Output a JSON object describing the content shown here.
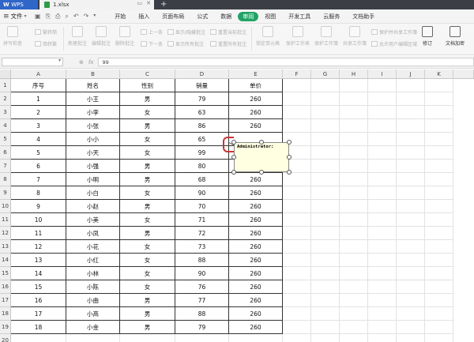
{
  "titlebar": {
    "app_name": "WPS",
    "file_name": "1.xlsx"
  },
  "menubar": {
    "file_label": "文件",
    "items": [
      "开始",
      "插入",
      "页面布局",
      "公式",
      "数据",
      "审阅",
      "视图",
      "开发工具",
      "云服务",
      "文档助手"
    ],
    "active": "审阅"
  },
  "ribbon": {
    "spell_check": "拼写检查",
    "trad_to_simp": "繁转简",
    "simp_to_trad": "简转繁",
    "new_comment": "新建批注",
    "edit_comment": "编辑批注",
    "delete_comment": "删除批注",
    "prev": "上一条",
    "next": "下一条",
    "show_hide_comment": "显示/隐藏批注",
    "show_all_comments": "显示所有批注",
    "reset_current_comment": "重置当前批注",
    "reset_all_comments": "重置所有批注",
    "lock_cell": "锁定单元格",
    "protect_sheet": "保护工作表",
    "protect_workbook": "保护工作簿",
    "share_workbook": "共享工作簿",
    "protect_and_share": "保护并共享工作簿",
    "allow_edit_ranges": "允许用户编辑区域",
    "track_changes": "修订",
    "doc_encrypt": "文档加密"
  },
  "formulabar": {
    "fx": "fx",
    "value": "99"
  },
  "grid": {
    "columns": [
      "A",
      "B",
      "C",
      "D",
      "E",
      "F",
      "G",
      "H",
      "I",
      "J",
      "K"
    ],
    "header_row": [
      "序号",
      "姓名",
      "性别",
      "销量",
      "单价"
    ],
    "rows": [
      [
        "1",
        "小王",
        "男",
        "79",
        "260"
      ],
      [
        "2",
        "小李",
        "女",
        "63",
        "260"
      ],
      [
        "3",
        "小张",
        "男",
        "86",
        "260"
      ],
      [
        "4",
        "小小",
        "女",
        "65",
        ""
      ],
      [
        "5",
        "小天",
        "女",
        "99",
        ""
      ],
      [
        "6",
        "小强",
        "男",
        "80",
        ""
      ],
      [
        "7",
        "小明",
        "男",
        "68",
        "260"
      ],
      [
        "8",
        "小白",
        "女",
        "90",
        "260"
      ],
      [
        "9",
        "小赵",
        "男",
        "70",
        "260"
      ],
      [
        "10",
        "小美",
        "女",
        "71",
        "260"
      ],
      [
        "11",
        "小凤",
        "男",
        "72",
        "260"
      ],
      [
        "12",
        "小花",
        "女",
        "73",
        "260"
      ],
      [
        "13",
        "小红",
        "女",
        "88",
        "260"
      ],
      [
        "14",
        "小林",
        "女",
        "90",
        "260"
      ],
      [
        "15",
        "小陈",
        "女",
        "76",
        "260"
      ],
      [
        "16",
        "小曲",
        "男",
        "77",
        "260"
      ],
      [
        "17",
        "小高",
        "男",
        "88",
        "260"
      ],
      [
        "18",
        "小金",
        "男",
        "79",
        "260"
      ]
    ],
    "row_numbers": [
      "1",
      "2",
      "3",
      "4",
      "5",
      "6",
      "7",
      "8",
      "9",
      "10",
      "11",
      "12",
      "13",
      "14",
      "15",
      "16",
      "17",
      "18",
      "19",
      "20"
    ]
  },
  "comment": {
    "author": "Administrator:"
  }
}
